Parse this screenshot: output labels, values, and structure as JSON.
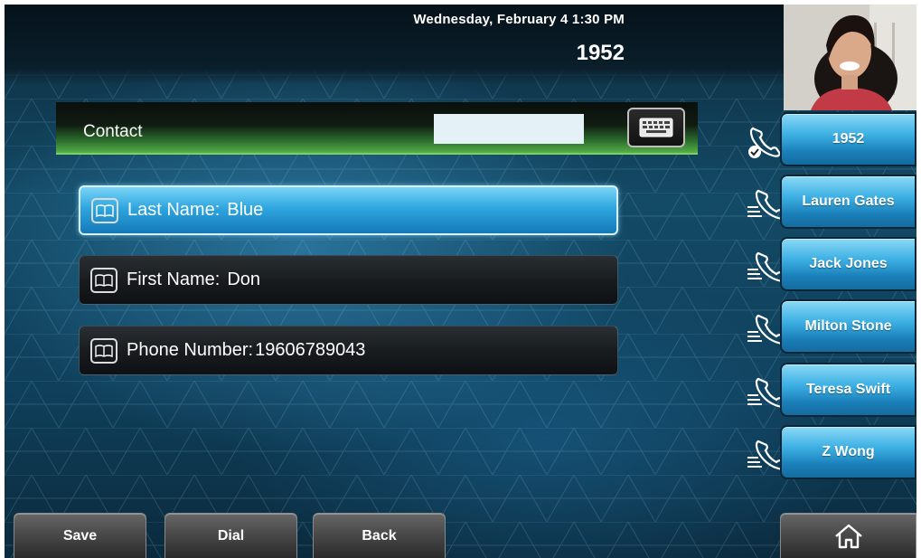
{
  "status": {
    "datetime": "Wednesday, February 4  1:30 PM",
    "line_number": "1952"
  },
  "contact_bar": {
    "label": "Contact",
    "search_value": "",
    "keyboard_icon": "keyboard-icon"
  },
  "fields": [
    {
      "label": "Last Name:",
      "value": "Blue",
      "selected": true
    },
    {
      "label": "First Name:",
      "value": "Don",
      "selected": false
    },
    {
      "label": "Phone Number:",
      "value": "19606789043",
      "selected": false
    }
  ],
  "lines": [
    {
      "label": "1952",
      "icon": "phone-registered-icon"
    },
    {
      "label": "Lauren Gates",
      "icon": "speed-dial-icon"
    },
    {
      "label": "Jack Jones",
      "icon": "speed-dial-icon"
    },
    {
      "label": "Milton Stone",
      "icon": "speed-dial-icon"
    },
    {
      "label": "Teresa Swift",
      "icon": "speed-dial-icon"
    },
    {
      "label": "Z Wong",
      "icon": "speed-dial-icon"
    }
  ],
  "softkeys": {
    "save": "Save",
    "dial": "Dial",
    "back": "Back",
    "home_icon": "home-icon"
  },
  "colors": {
    "accent_blue": "#2fa6e0",
    "contact_green": "#56b04a",
    "softkey_gray": "#4a4a4a"
  }
}
